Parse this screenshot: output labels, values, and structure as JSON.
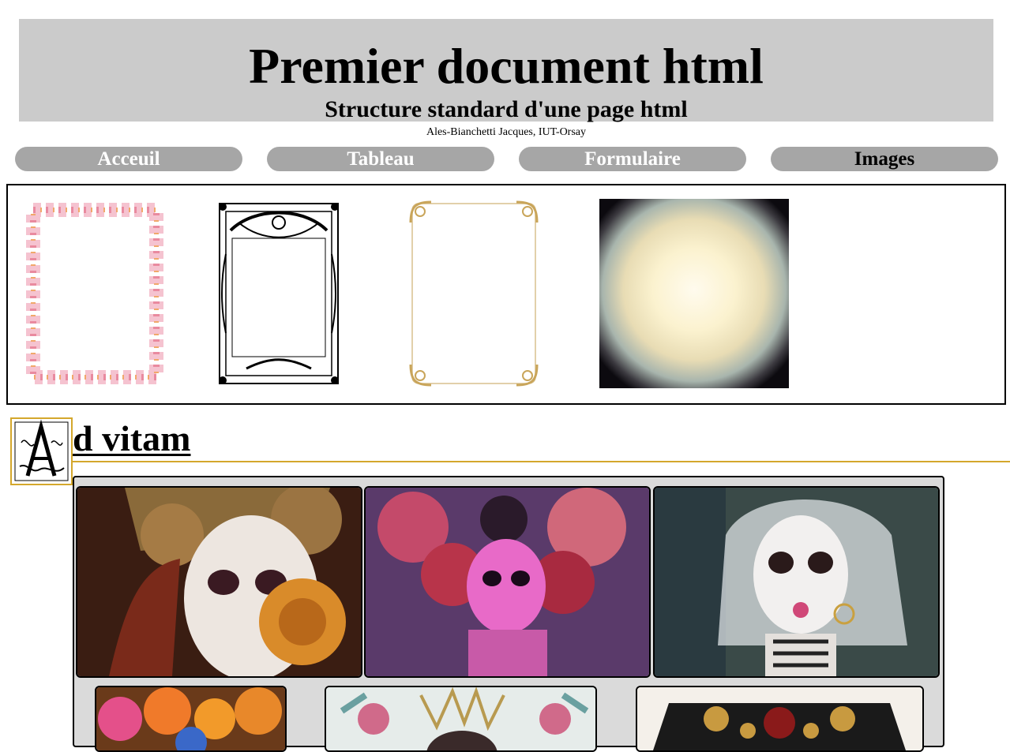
{
  "header": {
    "title": "Premier document html",
    "subtitle": "Structure standard d'une page html",
    "author": "Ales-Bianchetti Jacques, IUT-Orsay"
  },
  "nav": {
    "items": [
      "Acceuil",
      "Tableau",
      "Formulaire",
      "Images"
    ],
    "active": "Images"
  },
  "section": {
    "drop_cap_letter": "A",
    "title": "d vitam"
  },
  "colors": {
    "header_bg": "#cbcbcb",
    "nav_bg": "#a6a6a6",
    "accent_gold": "#d4a72c",
    "gallery_bg": "#dadada"
  }
}
